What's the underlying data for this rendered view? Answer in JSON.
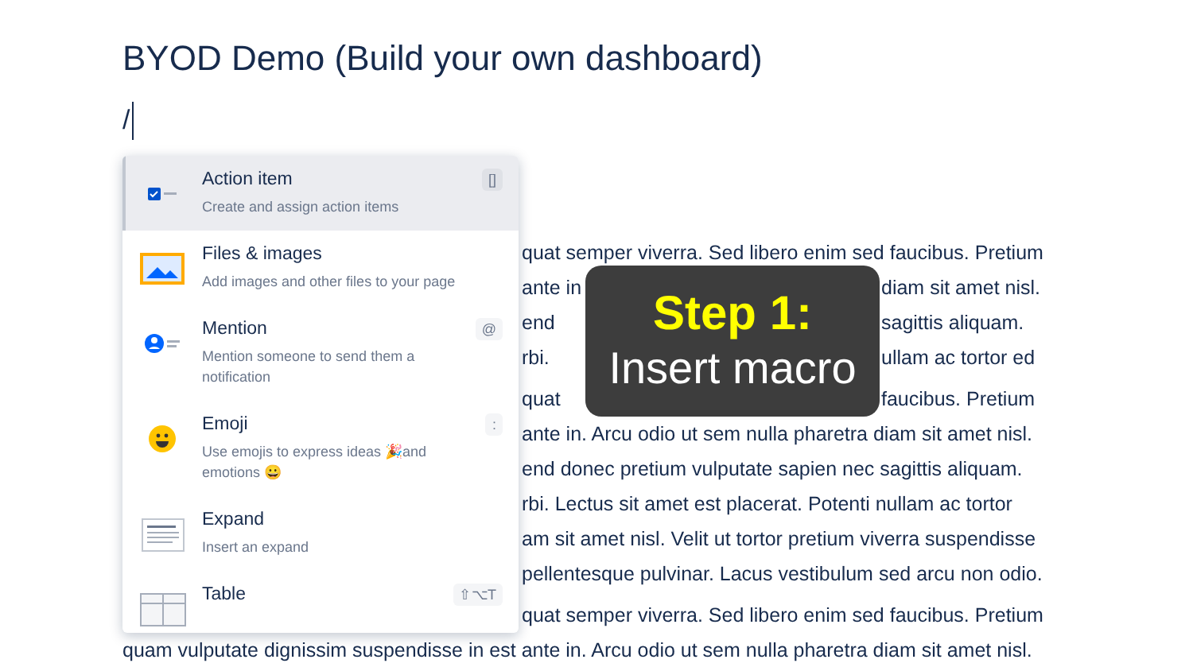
{
  "page": {
    "title": "BYOD Demo (Build your own dashboard)",
    "editor_line": "/"
  },
  "paragraphs": [
    {
      "lines": [
        {
          "kind": "clipped",
          "text": "quat semper viverra. Sed libero enim sed faucibus. Pretium"
        },
        {
          "kind": "split",
          "left": "ante in",
          "right": "diam sit amet nisl."
        },
        {
          "kind": "split",
          "left": "end",
          "right": "sagittis aliquam."
        },
        {
          "kind": "split",
          "left": "rbi.",
          "right": "ullam ac tortor ed"
        }
      ]
    },
    {
      "lines": [
        {
          "kind": "split",
          "left": "quat",
          "right": "faucibus. Pretium"
        },
        {
          "kind": "clipped",
          "text": "ante in. Arcu odio ut sem nulla pharetra diam sit amet nisl."
        },
        {
          "kind": "clipped",
          "text": "end donec pretium vulputate sapien nec sagittis aliquam."
        },
        {
          "kind": "clipped",
          "text": "rbi. Lectus sit amet est placerat. Potenti nullam ac tortor"
        },
        {
          "kind": "clipped",
          "text": "am sit amet nisl. Velit ut tortor pretium viverra suspendisse"
        },
        {
          "kind": "clipped",
          "text": "pellentesque pulvinar. Lacus vestibulum sed arcu non odio."
        }
      ]
    },
    {
      "lines": [
        {
          "kind": "clipped",
          "text": "quat semper viverra. Sed libero enim sed faucibus. Pretium"
        },
        {
          "kind": "full",
          "text": "quam vulputate dignissim suspendisse in est ante in. Arcu odio ut sem nulla pharetra diam sit amet nisl."
        }
      ]
    }
  ],
  "menu": {
    "items": [
      {
        "kind": "action",
        "title": "Action item",
        "description": "Create and assign action items",
        "shortcut": "[]",
        "selected": true
      },
      {
        "kind": "files",
        "title": "Files & images",
        "description": "Add images and other files to your page",
        "selected": false
      },
      {
        "kind": "mention",
        "title": "Mention",
        "description": "Mention someone to send them a notification",
        "shortcut": "@",
        "selected": false
      },
      {
        "kind": "emoji",
        "title": "Emoji",
        "description": "Use emojis to express ideas 🎉and emotions 😀",
        "shortcut": ":",
        "selected": false
      },
      {
        "kind": "expand",
        "title": "Expand",
        "description": "Insert an expand",
        "selected": false
      },
      {
        "kind": "table",
        "title": "Table",
        "shortcut": "⇧⌥T",
        "selected": false
      }
    ]
  },
  "overlay": {
    "heading": "Step 1:",
    "caption": "Insert macro"
  }
}
